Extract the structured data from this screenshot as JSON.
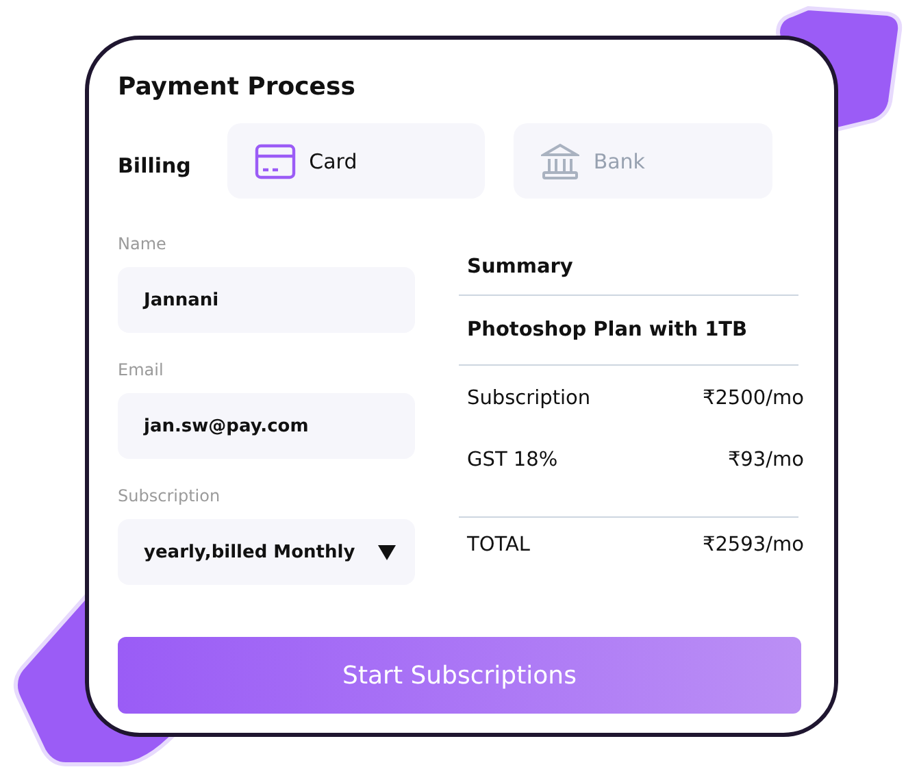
{
  "title": "Payment Process",
  "billing": {
    "label": "Billing",
    "options": [
      {
        "label": "Card",
        "kind": "card",
        "selected": true
      },
      {
        "label": "Bank",
        "kind": "bank",
        "selected": false
      }
    ]
  },
  "fields": [
    {
      "label": "Name",
      "value": "Jannani",
      "kind": "text"
    },
    {
      "label": "Email",
      "value": "jan.sw@pay.com",
      "kind": "text"
    },
    {
      "label": "Subscription",
      "value": "yearly,billed Monthly",
      "kind": "select"
    }
  ],
  "summary": {
    "title": "Summary",
    "plan": "Photoshop Plan with 1TB",
    "rows": [
      {
        "label": "Subscription",
        "amount": "₹2500/mo",
        "kind": "line"
      },
      {
        "label": "GST 18%",
        "amount": "₹93/mo",
        "kind": "line"
      },
      {
        "label": "TOTAL",
        "amount": "₹2593/mo",
        "kind": "total"
      }
    ]
  },
  "button": "Start Subscriptions"
}
